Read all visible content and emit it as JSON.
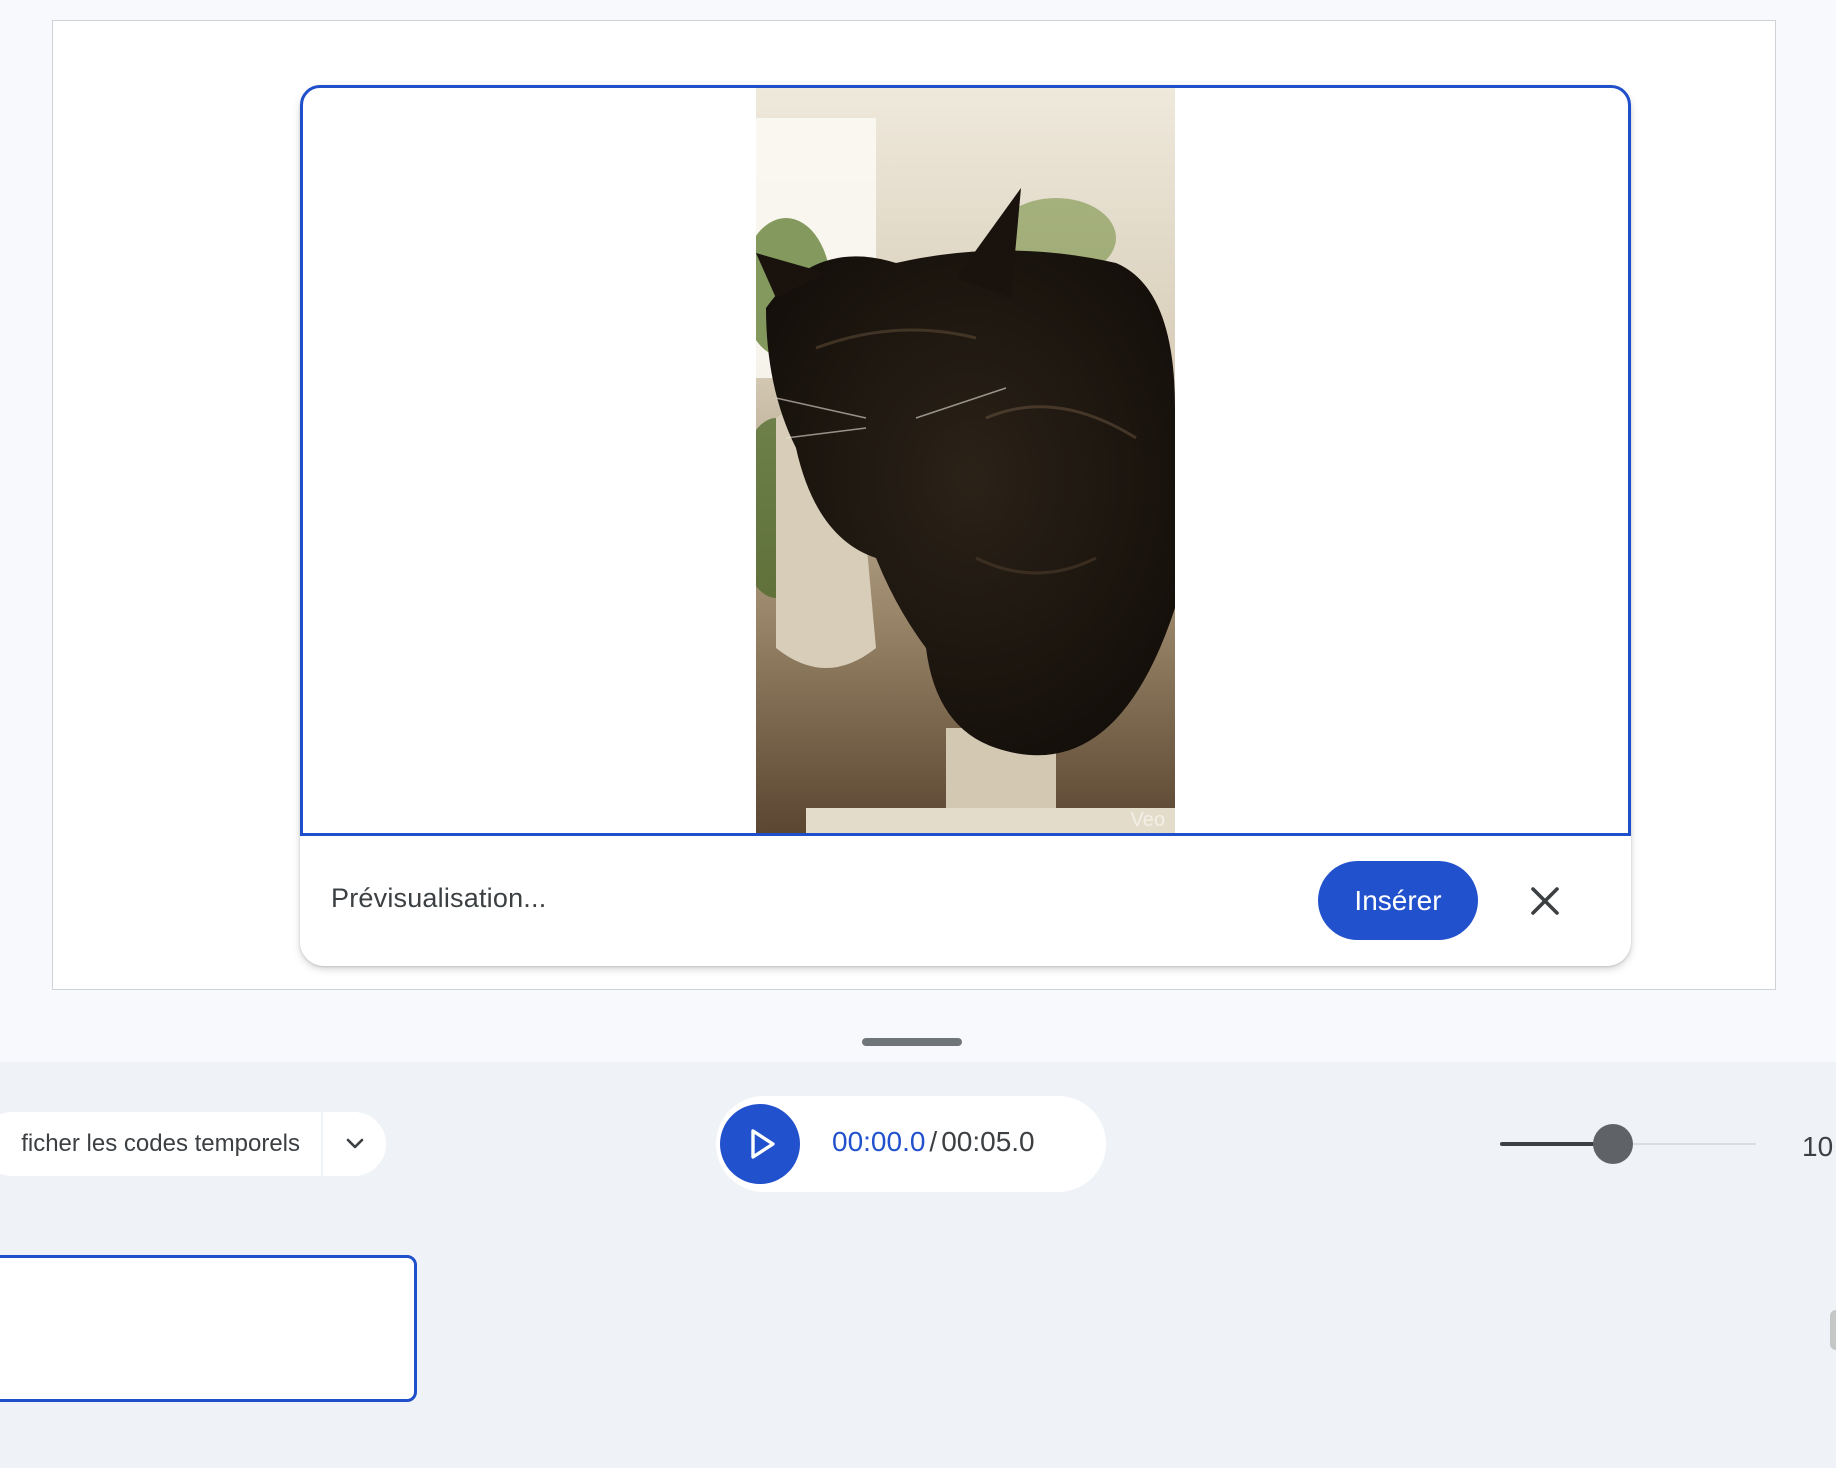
{
  "preview": {
    "status_label": "Prévisualisation...",
    "insert_label": "Insérer",
    "close_icon": "close-icon",
    "watermark": "Veo",
    "video_subject": "cat-video-frame"
  },
  "toolbar": {
    "timecode_toggle_label": "ficher les codes temporels",
    "dropdown_icon": "chevron-down-icon",
    "play_icon": "play-icon",
    "current_time": "00:00.0",
    "separator": "/",
    "total_time": "00:05.0",
    "zoom_value_text": "10",
    "zoom_level_fraction": 0.44
  },
  "colors": {
    "accent": "#2151cc",
    "panel_bg": "#eff3f8",
    "page_bg": "#f8f9fd"
  }
}
